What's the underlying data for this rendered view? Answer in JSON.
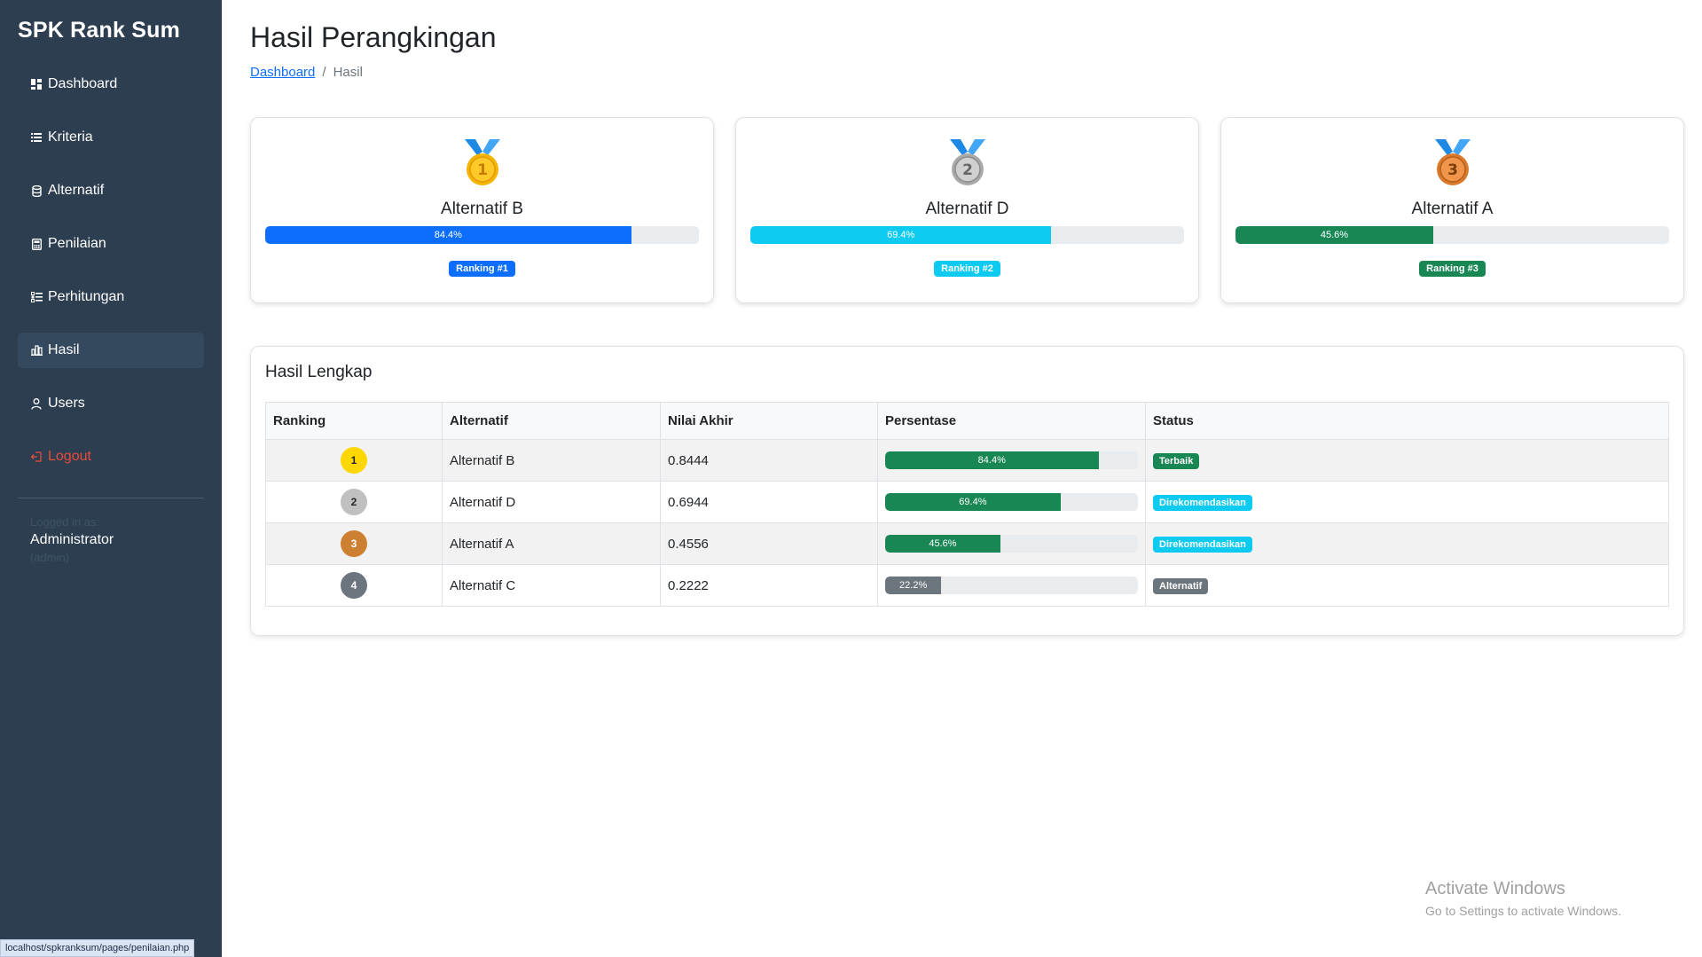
{
  "sidebar": {
    "brand": "SPK Rank Sum",
    "items": [
      {
        "label": "Dashboard",
        "icon": "grid-icon"
      },
      {
        "label": "Kriteria",
        "icon": "list-icon"
      },
      {
        "label": "Alternatif",
        "icon": "database-icon"
      },
      {
        "label": "Penilaian",
        "icon": "calculator-icon"
      },
      {
        "label": "Perhitungan",
        "icon": "list-task-icon"
      },
      {
        "label": "Hasil",
        "icon": "bar-chart-icon"
      },
      {
        "label": "Users",
        "icon": "person-icon"
      },
      {
        "label": "Logout",
        "icon": "logout-icon"
      }
    ],
    "user": {
      "logged_in_as": "Logged in as:",
      "name": "Administrator",
      "role": "(admin)"
    }
  },
  "page": {
    "title": "Hasil Perangkingan",
    "breadcrumb_link": "Dashboard",
    "breadcrumb_sep": "/",
    "breadcrumb_current": "Hasil"
  },
  "cards": [
    {
      "name": "Alternatif B",
      "percent": 84.4,
      "percent_label": "84.4%",
      "rank_label": "Ranking #1",
      "medal_number": "1",
      "color": "#0d6efd"
    },
    {
      "name": "Alternatif D",
      "percent": 69.4,
      "percent_label": "69.4%",
      "rank_label": "Ranking #2",
      "medal_number": "2",
      "color": "#0dcaf0"
    },
    {
      "name": "Alternatif A",
      "percent": 45.6,
      "percent_label": "45.6%",
      "rank_label": "Ranking #3",
      "medal_number": "3",
      "color": "#198754"
    }
  ],
  "table": {
    "title": "Hasil Lengkap",
    "headers": [
      "Ranking",
      "Alternatif",
      "Nilai Akhir",
      "Persentase",
      "Status"
    ],
    "rows": [
      {
        "rank": "1",
        "alternatif": "Alternatif B",
        "nilai": "0.8444",
        "percent": 84.4,
        "percent_label": "84.4%",
        "status": "Terbaik",
        "status_color": "#198754",
        "rank_color": "#ffd700",
        "rank_text_color": "#212529"
      },
      {
        "rank": "2",
        "alternatif": "Alternatif D",
        "nilai": "0.6944",
        "percent": 69.4,
        "percent_label": "69.4%",
        "status": "Direkomendasikan",
        "status_color": "#0dcaf0",
        "rank_color": "#c0c0c0",
        "rank_text_color": "#212529"
      },
      {
        "rank": "3",
        "alternatif": "Alternatif A",
        "nilai": "0.4556",
        "percent": 45.6,
        "percent_label": "45.6%",
        "status": "Direkomendasikan",
        "status_color": "#0dcaf0",
        "rank_color": "#cd7f32",
        "rank_text_color": "#ffffff"
      },
      {
        "rank": "4",
        "alternatif": "Alternatif C",
        "nilai": "0.2222",
        "percent": 22.2,
        "percent_label": "22.2%",
        "status": "Alternatif",
        "status_color": "#6c757d",
        "rank_color": "#6c757d",
        "rank_text_color": "#ffffff"
      }
    ],
    "bar_colors": [
      "#198754",
      "#198754",
      "#198754",
      "#6c757d"
    ]
  },
  "watermark": {
    "line1": "Activate Windows",
    "line2": "Go to Settings to activate Windows."
  },
  "statusbar": {
    "url": "localhost/spkranksum/pages/penilaian.php"
  }
}
